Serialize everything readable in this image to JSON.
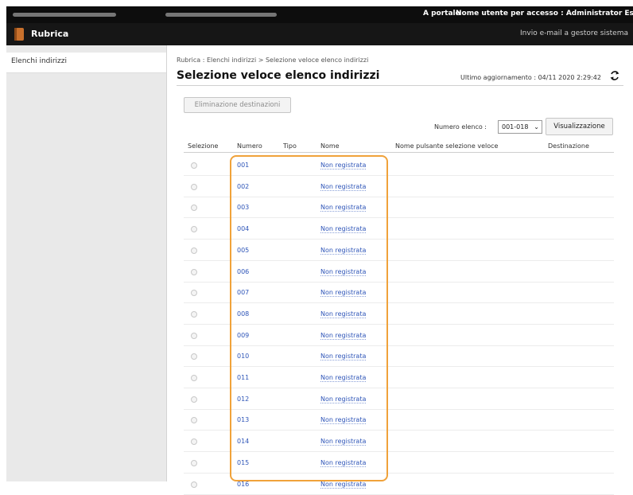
{
  "header": {
    "portal": "A portale",
    "user_label": "Nome utente per accesso :  Administrator  Esci"
  },
  "app": {
    "title": "Rubrica",
    "mail_link": "Invio e-mail a gestore sistema"
  },
  "sidebar": {
    "items": [
      {
        "label": "Elenchi indirizzi"
      }
    ]
  },
  "main": {
    "breadcrumb": "Rubrica : Elenchi indirizzi > Selezione veloce elenco indirizzi",
    "title": "Selezione veloce elenco indirizzi",
    "last_update": "Ultimo aggiornamento : 04/11 2020 2:29:42",
    "delete_button": "Eliminazione destinazioni",
    "list_number_label": "Numero elenco :",
    "list_number_value": "001-018",
    "view_button": "Visualizzazione"
  },
  "table": {
    "headers": [
      "Selezione",
      "Numero",
      "Tipo",
      "Nome",
      "Nome pulsante selezione veloce",
      "Destinazione"
    ],
    "rows": [
      {
        "number": "001",
        "name": "Non registrata"
      },
      {
        "number": "002",
        "name": "Non registrata"
      },
      {
        "number": "003",
        "name": "Non registrata"
      },
      {
        "number": "004",
        "name": "Non registrata"
      },
      {
        "number": "005",
        "name": "Non registrata"
      },
      {
        "number": "006",
        "name": "Non registrata"
      },
      {
        "number": "007",
        "name": "Non registrata"
      },
      {
        "number": "008",
        "name": "Non registrata"
      },
      {
        "number": "009",
        "name": "Non registrata"
      },
      {
        "number": "010",
        "name": "Non registrata"
      },
      {
        "number": "011",
        "name": "Non registrata"
      },
      {
        "number": "012",
        "name": "Non registrata"
      },
      {
        "number": "013",
        "name": "Non registrata"
      },
      {
        "number": "014",
        "name": "Non registrata"
      },
      {
        "number": "015",
        "name": "Non registrata"
      },
      {
        "number": "016",
        "name": "Non registrata"
      }
    ]
  },
  "colors": {
    "top_bar": "#0d0d0d",
    "app_bar": "#161616",
    "link": "#2e55b8",
    "highlight_border": "#f0a23a",
    "book_icon": "#c8702c"
  },
  "icons": [
    "rubrica-book-icon",
    "refresh-icon",
    "chevron-down-icon"
  ]
}
